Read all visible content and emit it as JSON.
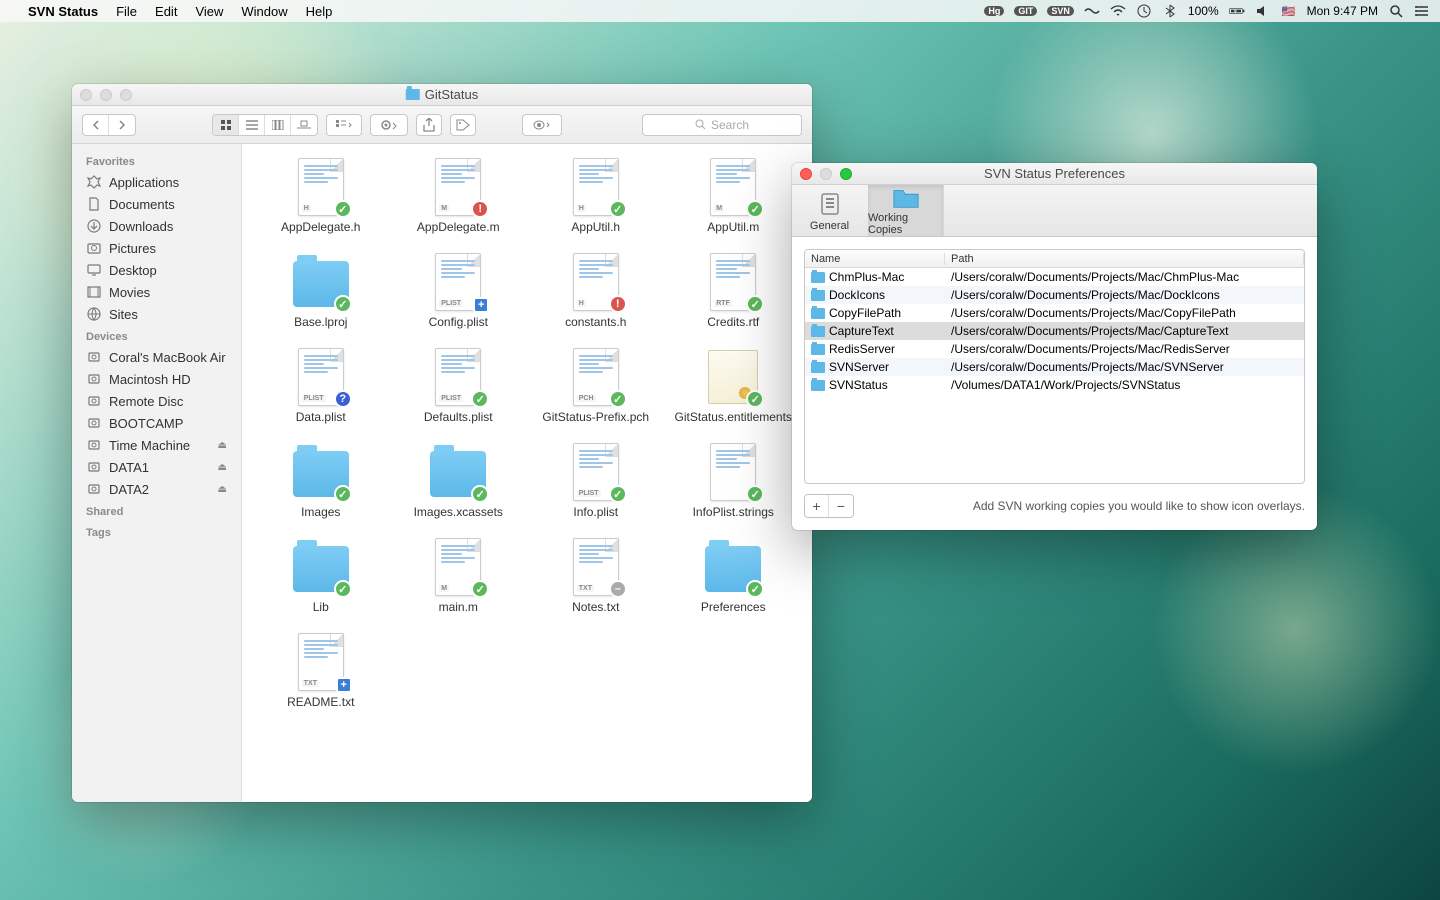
{
  "menubar": {
    "app_name": "SVN Status",
    "menus": [
      "File",
      "Edit",
      "View",
      "Window",
      "Help"
    ],
    "status_icons": [
      "Hg",
      "GIT",
      "SVN"
    ],
    "battery": "100%",
    "clock": "Mon 9:47 PM"
  },
  "finder": {
    "title": "GitStatus",
    "search_placeholder": "Search",
    "sidebar": {
      "favorites_header": "Favorites",
      "favorites": [
        "Applications",
        "Documents",
        "Downloads",
        "Pictures",
        "Desktop",
        "Movies",
        "Sites"
      ],
      "devices_header": "Devices",
      "devices": [
        {
          "label": "Coral's MacBook Air",
          "eject": false
        },
        {
          "label": "Macintosh HD",
          "eject": false
        },
        {
          "label": "Remote Disc",
          "eject": false
        },
        {
          "label": "BOOTCAMP",
          "eject": false
        },
        {
          "label": "Time Machine",
          "eject": true
        },
        {
          "label": "DATA1",
          "eject": true
        },
        {
          "label": "DATA2",
          "eject": true
        }
      ],
      "shared_header": "Shared",
      "tags_header": "Tags"
    },
    "files": [
      {
        "name": "AppDelegate.h",
        "type": "doc",
        "ext": "H",
        "badge": "ok"
      },
      {
        "name": "AppDelegate.m",
        "type": "doc",
        "ext": "M",
        "badge": "warn"
      },
      {
        "name": "AppUtil.h",
        "type": "doc",
        "ext": "H",
        "badge": "ok"
      },
      {
        "name": "AppUtil.m",
        "type": "doc",
        "ext": "M",
        "badge": "ok"
      },
      {
        "name": "Base.lproj",
        "type": "folder",
        "badge": "ok"
      },
      {
        "name": "Config.plist",
        "type": "doc",
        "ext": "PLIST",
        "badge": "add"
      },
      {
        "name": "constants.h",
        "type": "doc",
        "ext": "H",
        "badge": "warn"
      },
      {
        "name": "Credits.rtf",
        "type": "doc",
        "ext": "RTF",
        "badge": "ok"
      },
      {
        "name": "Data.plist",
        "type": "doc",
        "ext": "PLIST",
        "badge": "q"
      },
      {
        "name": "Defaults.plist",
        "type": "doc",
        "ext": "PLIST",
        "badge": "ok"
      },
      {
        "name": "GitStatus-Prefix.pch",
        "type": "doc",
        "ext": "PCH",
        "badge": "ok"
      },
      {
        "name": "GitStatus.entitlements",
        "type": "cert",
        "badge": "ok"
      },
      {
        "name": "Images",
        "type": "folder",
        "badge": "ok"
      },
      {
        "name": "Images.xcassets",
        "type": "folder",
        "badge": "ok"
      },
      {
        "name": "Info.plist",
        "type": "doc",
        "ext": "PLIST",
        "badge": "ok"
      },
      {
        "name": "InfoPlist.strings",
        "type": "doc",
        "ext": "",
        "badge": "ok"
      },
      {
        "name": "Lib",
        "type": "folder",
        "badge": "ok"
      },
      {
        "name": "main.m",
        "type": "doc",
        "ext": "M",
        "badge": "ok"
      },
      {
        "name": "Notes.txt",
        "type": "doc",
        "ext": "TXT",
        "badge": "ign"
      },
      {
        "name": "Preferences",
        "type": "folder",
        "badge": "ok"
      },
      {
        "name": "README.txt",
        "type": "doc",
        "ext": "TXT",
        "badge": "add"
      }
    ]
  },
  "prefs": {
    "title": "SVN Status Preferences",
    "tabs": {
      "general": "General",
      "working_copies": "Working Copies"
    },
    "columns": {
      "name": "Name",
      "path": "Path"
    },
    "rows": [
      {
        "name": "ChmPlus-Mac",
        "path": "/Users/coralw/Documents/Projects/Mac/ChmPlus-Mac",
        "sel": false
      },
      {
        "name": "DockIcons",
        "path": "/Users/coralw/Documents/Projects/Mac/DockIcons",
        "sel": false
      },
      {
        "name": "CopyFilePath",
        "path": "/Users/coralw/Documents/Projects/Mac/CopyFilePath",
        "sel": false
      },
      {
        "name": "CaptureText",
        "path": "/Users/coralw/Documents/Projects/Mac/CaptureText",
        "sel": true
      },
      {
        "name": "RedisServer",
        "path": "/Users/coralw/Documents/Projects/Mac/RedisServer",
        "sel": false
      },
      {
        "name": "SVNServer",
        "path": "/Users/coralw/Documents/Projects/Mac/SVNServer",
        "sel": false
      },
      {
        "name": "SVNStatus",
        "path": "/Volumes/DATA1/Work/Projects/SVNStatus",
        "sel": false
      }
    ],
    "hint": "Add SVN working copies you would like to show icon overlays.",
    "add_label": "+",
    "remove_label": "−"
  }
}
